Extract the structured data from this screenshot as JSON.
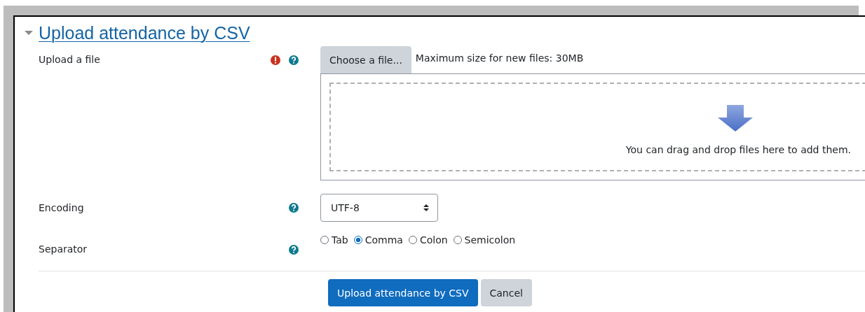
{
  "section": {
    "title": "Upload attendance by CSV",
    "expanded": true
  },
  "file_row": {
    "label": "Upload a file",
    "required": true,
    "help": true,
    "choose_button": "Choose a file...",
    "max_size": "Maximum size for new files: 30MB",
    "drop_hint": "You can drag and drop files here to add them."
  },
  "encoding_row": {
    "label": "Encoding",
    "help": true,
    "value": "UTF-8"
  },
  "separator_row": {
    "label": "Separator",
    "help": true,
    "options": [
      {
        "label": "Tab",
        "selected": false
      },
      {
        "label": "Comma",
        "selected": true
      },
      {
        "label": "Colon",
        "selected": false
      },
      {
        "label": "Semicolon",
        "selected": false
      }
    ]
  },
  "buttons": [
    {
      "label": "Upload attendance by CSV",
      "kind": "primary"
    },
    {
      "label": "Cancel",
      "kind": "secondary"
    }
  ]
}
